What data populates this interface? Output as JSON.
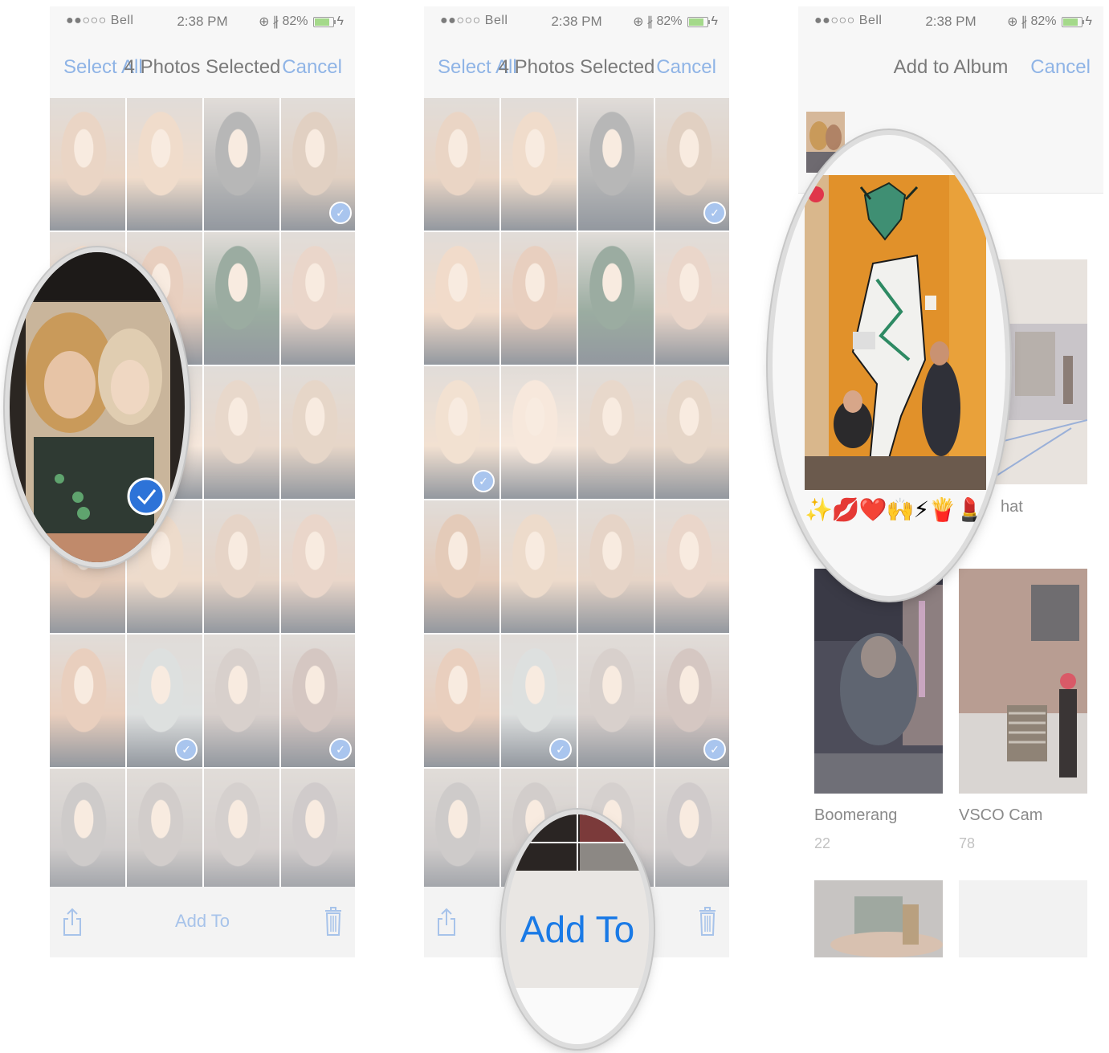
{
  "status": {
    "carrier": "●●○○○ Bell",
    "time": "2:38 PM",
    "battery": "82%",
    "battery_level": 0.82
  },
  "select_screen": {
    "select_all": "Select All",
    "title": "4 Photos Selected",
    "cancel": "Cancel",
    "add_to": "Add To"
  },
  "album_screen": {
    "title": "Add to Album",
    "cancel": "Cancel",
    "emoji_caption": "✨💋❤️🙌⚡🍟💄",
    "partial_label": "hat",
    "albums": [
      {
        "name": "Boomerang",
        "count": "22"
      },
      {
        "name": "VSCO Cam",
        "count": "78"
      }
    ]
  },
  "magnified_add_to": "Add To",
  "colors": {
    "accent": "#1a7ae6",
    "accent_faded": "#8fb4e6",
    "check": "#2d73d8"
  }
}
